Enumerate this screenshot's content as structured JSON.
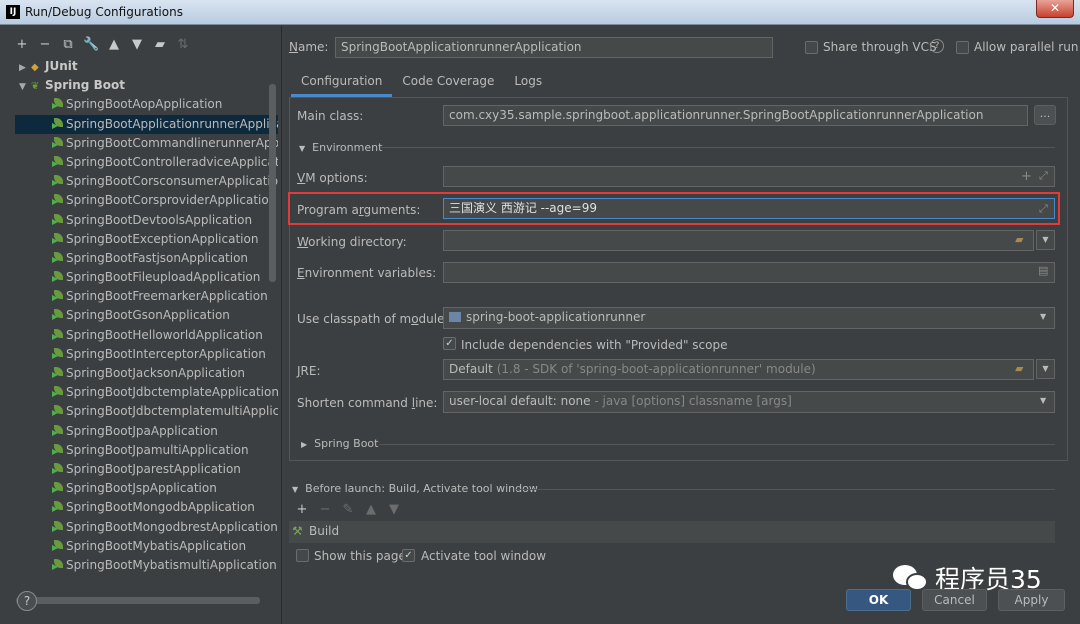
{
  "window": {
    "title": "Run/Debug Configurations",
    "close_label": "✕"
  },
  "toolbar": {
    "icons": [
      "add-icon",
      "remove-icon",
      "copy-icon",
      "wrench-icon",
      "move-up-icon",
      "move-down-icon",
      "folder-icon",
      "sort-icon"
    ]
  },
  "tree": {
    "groups": [
      {
        "label": "JUnit",
        "expanded": false
      },
      {
        "label": "Spring Boot",
        "expanded": true
      }
    ],
    "items": [
      "SpringBootAopApplication",
      "SpringBootApplicationrunnerApplication",
      "SpringBootCommandlinerunnerApplication",
      "SpringBootControlleradviceApplication",
      "SpringBootCorsconsumerApplication",
      "SpringBootCorsproviderApplication",
      "SpringBootDevtoolsApplication",
      "SpringBootExceptionApplication",
      "SpringBootFastjsonApplication",
      "SpringBootFileuploadApplication",
      "SpringBootFreemarkerApplication",
      "SpringBootGsonApplication",
      "SpringBootHelloworldApplication",
      "SpringBootInterceptorApplication",
      "SpringBootJacksonApplication",
      "SpringBootJdbctemplateApplication",
      "SpringBootJdbctemplatemultiApplication",
      "SpringBootJpaApplication",
      "SpringBootJpamultiApplication",
      "SpringBootJparestApplication",
      "SpringBootJspApplication",
      "SpringBootMongodbApplication",
      "SpringBootMongodbrestApplication",
      "SpringBootMybatisApplication",
      "SpringBootMybatismultiApplication"
    ],
    "selected_index": 1
  },
  "header": {
    "name_label": "Name:",
    "name_value": "SpringBootApplicationrunnerApplication",
    "share_label": "Share through VCS",
    "share_help": "?",
    "parallel_label": "Allow parallel run"
  },
  "tabs": [
    "Configuration",
    "Code Coverage",
    "Logs"
  ],
  "config": {
    "main_class_label": "Main class:",
    "main_class_value": "com.cxy35.sample.springboot.applicationrunner.SpringBootApplicationrunnerApplication",
    "dots_label": "...",
    "environment_label": "Environment",
    "vm_options_label": "VM options:",
    "vm_options_value": "",
    "program_args_label": "Program arguments:",
    "program_args_value": "三国演义 西游记 --age=99",
    "working_dir_label": "Working directory:",
    "working_dir_value": "",
    "env_vars_label": "Environment variables:",
    "env_vars_value": "",
    "classpath_label": "Use classpath of module:",
    "classpath_value": "spring-boot-applicationrunner",
    "include_deps_label": "Include dependencies with \"Provided\" scope",
    "include_deps_checked": true,
    "jre_label": "JRE:",
    "jre_value_main": "Default",
    "jre_value_hint": "(1.8 - SDK of 'spring-boot-applicationrunner' module)",
    "shorten_label": "Shorten command line:",
    "shorten_value_main": "user-local default: none",
    "shorten_value_hint": "- java [options] classname [args]",
    "spring_boot_section": "Spring Boot"
  },
  "before_launch": {
    "label": "Before launch: Build, Activate tool window",
    "task": "Build",
    "show_page_label": "Show this page",
    "show_page_checked": false,
    "activate_label": "Activate tool window",
    "activate_checked": true
  },
  "buttons": {
    "ok": "OK",
    "cancel": "Cancel",
    "apply": "Apply"
  },
  "watermark": "程序员35",
  "colors": {
    "accent": "#4a88c7",
    "highlight": "#e03c3c",
    "selected_row": "#0d293e",
    "ok_button": "#365880"
  }
}
